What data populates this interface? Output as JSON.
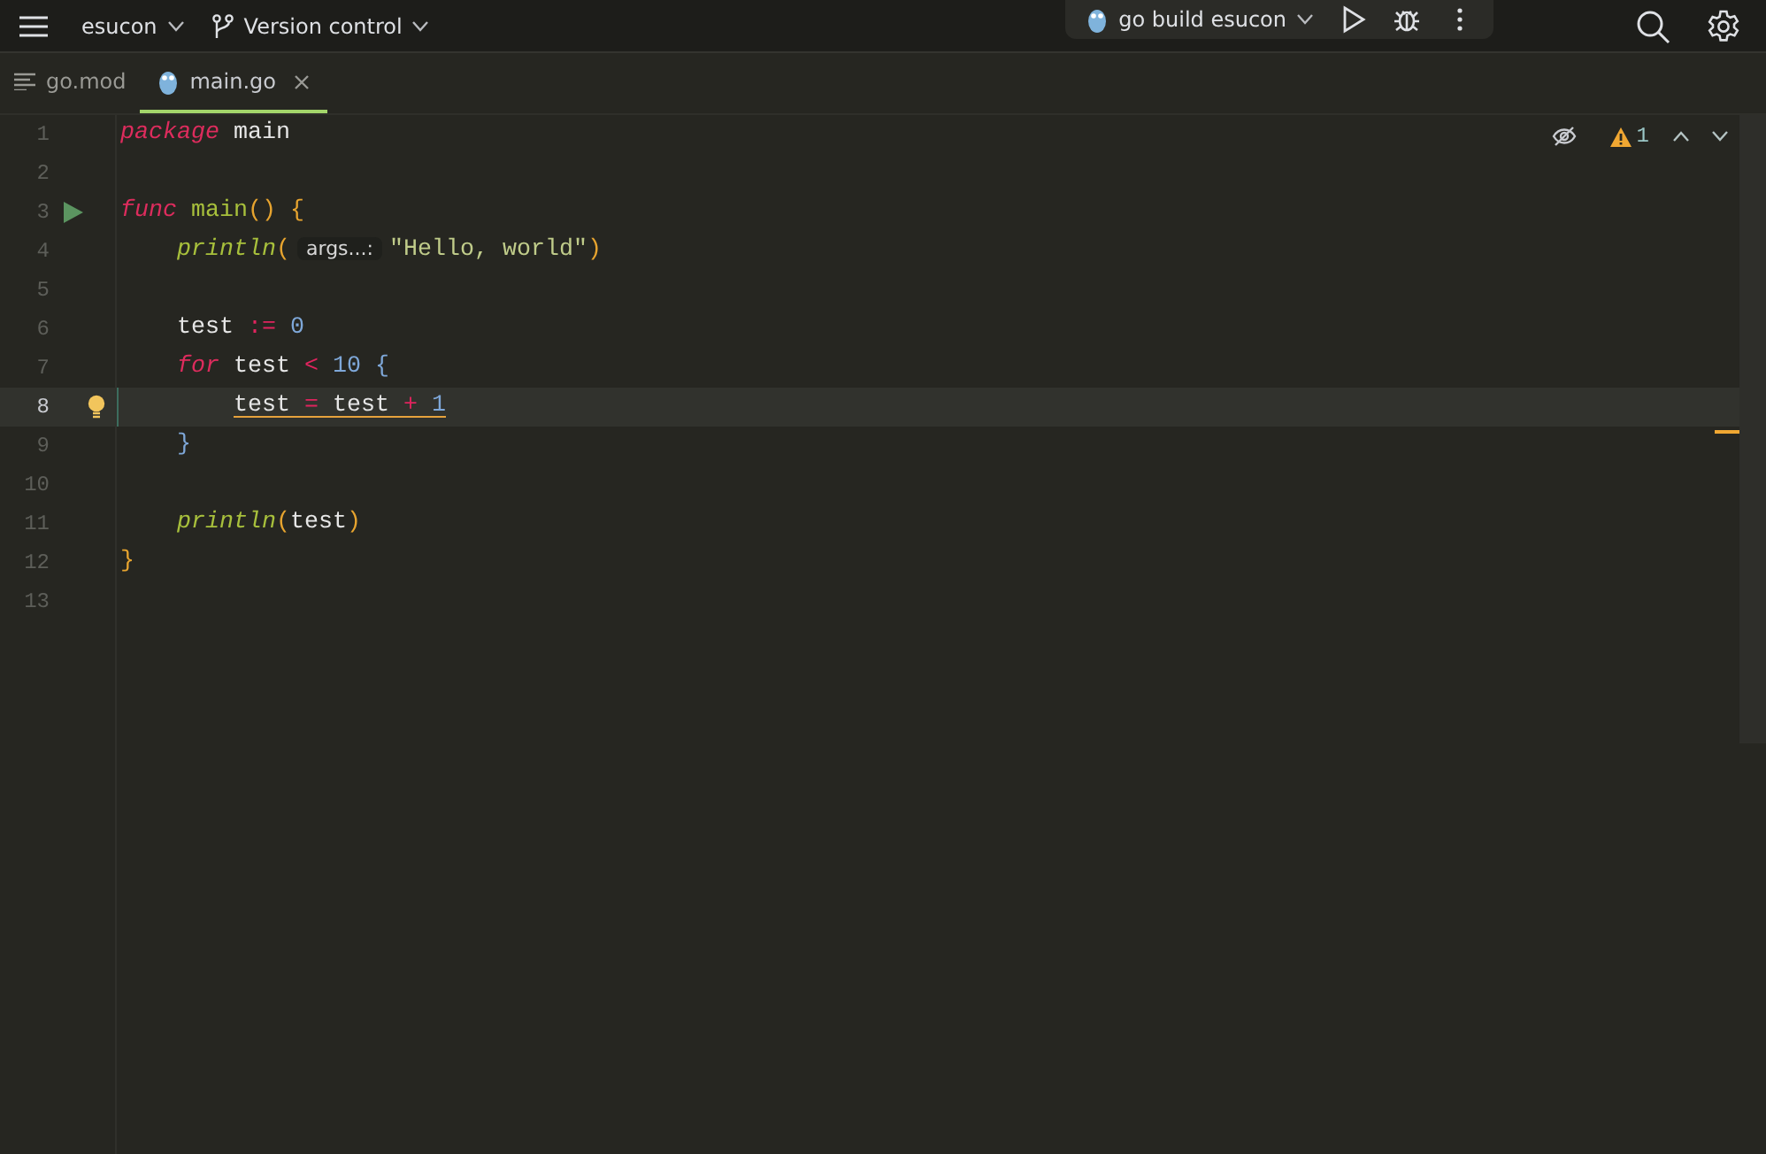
{
  "toolbar": {
    "project": "esucon",
    "vcs": "Version control",
    "run_config": "go build esucon"
  },
  "tabs": [
    {
      "label": "go.mod",
      "kind": "text",
      "selected": false,
      "closable": false
    },
    {
      "label": "main.go",
      "kind": "gopher",
      "selected": true,
      "closable": true
    }
  ],
  "inspections": {
    "warnings": "1"
  },
  "lines": [
    {
      "number": "1",
      "current": false,
      "warning": false,
      "kind": "code",
      "tokens": [
        {
          "kind": "kw",
          "text": "package"
        },
        {
          "kind": "plain",
          "text": " main"
        }
      ]
    },
    {
      "number": "2",
      "current": false,
      "warning": false,
      "kind": "code"
    },
    {
      "number": "3",
      "current": false,
      "warning": false,
      "kind": "run",
      "tokens": [
        {
          "kind": "kw",
          "text": "func"
        },
        {
          "kind": "fn",
          "text": " main"
        },
        {
          "kind": "paren",
          "text": "() {"
        }
      ],
      "children": [
        {
          "number": "4",
          "current": false,
          "warning": false,
          "kind": "code",
          "tokens": [
            {
              "kind": "call",
              "text": "println"
            },
            {
              "kind": "paren",
              "text": "("
            },
            {
              "kind": "hint",
              "text": "args...:"
            },
            {
              "kind": "str",
              "text": "\"Hello, world\""
            },
            {
              "kind": "paren",
              "text": ")"
            }
          ]
        },
        {
          "number": "5",
          "current": false,
          "warning": false,
          "kind": "code"
        },
        {
          "number": "6",
          "current": false,
          "warning": false,
          "kind": "code",
          "tokens": [
            {
              "kind": "plain",
              "text": "test "
            },
            {
              "kind": "op",
              "text": ":="
            },
            {
              "kind": "num",
              "text": " 0"
            }
          ]
        },
        {
          "number": "7",
          "current": false,
          "warning": false,
          "kind": "code",
          "tokens": [
            {
              "kind": "kw",
              "text": "for"
            },
            {
              "kind": "plain",
              "text": " test "
            },
            {
              "kind": "op",
              "text": "<"
            },
            {
              "kind": "num",
              "text": " 10"
            },
            {
              "kind": "brace",
              "text": " {"
            }
          ],
          "children": [
            {
              "number": "8",
              "current": true,
              "warning": true,
              "kind": "bulb",
              "tokens": [
                {
                  "kind": "plain",
                  "text": "test "
                },
                {
                  "kind": "op",
                  "text": "="
                },
                {
                  "kind": "plain",
                  "text": " test "
                },
                {
                  "kind": "op",
                  "text": "+"
                },
                {
                  "kind": "num",
                  "text": " 1"
                }
              ]
            }
          ]
        },
        {
          "number": "9",
          "current": false,
          "warning": false,
          "kind": "code",
          "tokens": [
            {
              "kind": "brace",
              "text": "}"
            }
          ]
        },
        {
          "number": "10",
          "current": false,
          "warning": false,
          "kind": "code"
        },
        {
          "number": "11",
          "current": false,
          "warning": false,
          "kind": "code",
          "tokens": [
            {
              "kind": "call",
              "text": "println"
            },
            {
              "kind": "paren",
              "text": "("
            },
            {
              "kind": "plain",
              "text": "test"
            },
            {
              "kind": "paren",
              "text": ")"
            }
          ]
        }
      ]
    },
    {
      "number": "12",
      "current": false,
      "warning": false,
      "kind": "code",
      "tokens": [
        {
          "kind": "paren",
          "text": "}"
        }
      ]
    },
    {
      "number": "13",
      "current": false,
      "warning": false,
      "kind": "code"
    }
  ]
}
